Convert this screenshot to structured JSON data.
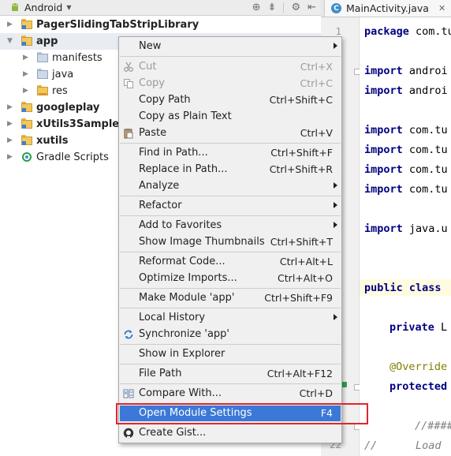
{
  "project_panel": {
    "view_label": "Android",
    "tree": [
      {
        "label": "PagerSlidingTabStripLibrary",
        "bold": true,
        "type": "module",
        "expanded": false
      },
      {
        "label": "app",
        "bold": true,
        "type": "module",
        "expanded": true,
        "selected": true
      },
      {
        "label": "manifests",
        "bold": false,
        "type": "folder"
      },
      {
        "label": "java",
        "bold": false,
        "type": "folder"
      },
      {
        "label": "res",
        "bold": false,
        "type": "res-folder"
      },
      {
        "label": "googleplay",
        "bold": true,
        "type": "module",
        "expanded": false
      },
      {
        "label": "xUtils3Sample",
        "bold": true,
        "type": "module",
        "expanded": false
      },
      {
        "label": "xutils",
        "bold": true,
        "type": "module",
        "expanded": false
      },
      {
        "label": "Gradle Scripts",
        "bold": false,
        "type": "gradle",
        "expanded": false
      }
    ]
  },
  "editor": {
    "tab_title": "MainActivity.java",
    "line_numbers": [
      "1",
      "22"
    ],
    "code": {
      "l1_kw": "package",
      "l1_rest": " com.tu",
      "l3_kw": "import",
      "l3_rest": " androi",
      "l4_kw": "import",
      "l4_rest": " androi",
      "l6_kw": "import",
      "l6_rest": " com.tu",
      "l7_kw": "import",
      "l7_rest": " com.tu",
      "l8_kw": "import",
      "l8_rest": " com.tu",
      "l9_kw": "import",
      "l9_rest": " com.tu",
      "l11_kw": "import",
      "l11_rest": " java.u",
      "l14_kw": "public class",
      "l14_rest": "",
      "l16_kw": "private",
      "l16_rest": " L",
      "l18_ann": "@Override",
      "l19_kw": "protected",
      "l21_cmt": "//####",
      "l22_cmt": "//      Load"
    }
  },
  "context_menu": {
    "items": [
      {
        "label": "New",
        "shortcut": "",
        "submenu": true,
        "icon": ""
      },
      {
        "label": "Cut",
        "shortcut": "Ctrl+X",
        "disabled": true,
        "icon": "scissors-icon"
      },
      {
        "label": "Copy",
        "shortcut": "Ctrl+C",
        "disabled": true,
        "icon": "copy-icon"
      },
      {
        "label": "Copy Path",
        "shortcut": "Ctrl+Shift+C"
      },
      {
        "label": "Copy as Plain Text",
        "shortcut": ""
      },
      {
        "label": "Paste",
        "shortcut": "Ctrl+V",
        "icon": "clipboard-icon"
      },
      {
        "label": "Find in Path...",
        "shortcut": "Ctrl+Shift+F"
      },
      {
        "label": "Replace in Path...",
        "shortcut": "Ctrl+Shift+R"
      },
      {
        "label": "Analyze",
        "shortcut": "",
        "submenu": true
      },
      {
        "label": "Refactor",
        "shortcut": "",
        "submenu": true
      },
      {
        "label": "Add to Favorites",
        "shortcut": "",
        "submenu": true
      },
      {
        "label": "Show Image Thumbnails",
        "shortcut": "Ctrl+Shift+T"
      },
      {
        "label": "Reformat Code...",
        "shortcut": "Ctrl+Alt+L"
      },
      {
        "label": "Optimize Imports...",
        "shortcut": "Ctrl+Alt+O"
      },
      {
        "label": "Make Module 'app'",
        "shortcut": "Ctrl+Shift+F9"
      },
      {
        "label": "Local History",
        "shortcut": "",
        "submenu": true
      },
      {
        "label": "Synchronize 'app'",
        "shortcut": "",
        "icon": "sync-icon"
      },
      {
        "label": "Show in Explorer",
        "shortcut": ""
      },
      {
        "label": "File Path",
        "shortcut": "Ctrl+Alt+F12"
      },
      {
        "label": "Compare With...",
        "shortcut": "Ctrl+D",
        "icon": "compare-icon"
      },
      {
        "label": "Open Module Settings",
        "shortcut": "F4",
        "active": true
      },
      {
        "label": "Create Gist...",
        "shortcut": "",
        "icon": "github-icon"
      }
    ]
  },
  "colors": {
    "menu_selection": "#3b78d8",
    "highlight_border": "#e0262a",
    "keyword": "#000080"
  }
}
